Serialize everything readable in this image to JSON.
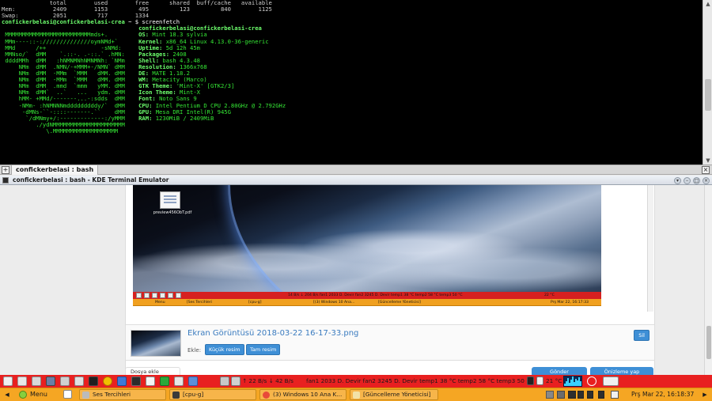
{
  "terminal": {
    "lines": [
      [
        {
          "t": "              total        used        free      shared  buff/cache   available",
          "c": "t-dim"
        }
      ],
      [
        {
          "t": "Mem:           2409        1153         495         123         840        1125",
          "c": "t-dim"
        }
      ],
      [
        {
          "t": "Swap:          2051         717        1334",
          "c": "t-dim"
        }
      ],
      [
        {
          "t": "confickerbelasi@confickerbelasi-crea",
          "c": "t-bgreen"
        },
        {
          "t": " ~ $ screenfetch",
          "c": "t-white"
        }
      ],
      [
        {
          "t": "                                        ",
          "c": ""
        },
        {
          "t": "confickerbelasi@confickerbelasi-crea",
          "c": "t-bgreen"
        }
      ],
      [
        {
          "t": " MMMMMMMMMMMMMMMMMMMMMMMMMmds+.         ",
          "c": "t-green"
        },
        {
          "t": "OS: ",
          "c": "t-bgreen"
        },
        {
          "t": "Mint 18.3 sylvia",
          "c": "t-green"
        }
      ],
      [
        {
          "t": " MMm----::-://////////////oymNMd+`      ",
          "c": "t-green"
        },
        {
          "t": "Kernel: ",
          "c": "t-bgreen"
        },
        {
          "t": "x86_64 Linux 4.13.0-36-generic",
          "c": "t-green"
        }
      ],
      [
        {
          "t": " MMd      /++                -sNMd:     ",
          "c": "t-green"
        },
        {
          "t": "Uptime: ",
          "c": "t-bgreen"
        },
        {
          "t": "5d 12h 45m",
          "c": "t-green"
        }
      ],
      [
        {
          "t": " MMNso/`  dMM    `.::-. .-::.` .hMN:    ",
          "c": "t-green"
        },
        {
          "t": "Packages: ",
          "c": "t-bgreen"
        },
        {
          "t": "2408",
          "c": "t-green"
        }
      ],
      [
        {
          "t": " ddddMMh  dMM   :hNMNMNhNMNMNh: `NMm    ",
          "c": "t-green"
        },
        {
          "t": "Shell: ",
          "c": "t-bgreen"
        },
        {
          "t": "bash 4.3.48",
          "c": "t-green"
        }
      ],
      [
        {
          "t": "     NMm  dMM  .NMN/-+MMM+-/NMN` dMM    ",
          "c": "t-green"
        },
        {
          "t": "Resolution: ",
          "c": "t-bgreen"
        },
        {
          "t": "1366x768",
          "c": "t-green"
        }
      ],
      [
        {
          "t": "     NMm  dMM  -MMm  `MMM   dMM. dMM    ",
          "c": "t-green"
        },
        {
          "t": "DE: ",
          "c": "t-bgreen"
        },
        {
          "t": "MATE 1.18.2",
          "c": "t-green"
        }
      ],
      [
        {
          "t": "     NMm  dMM  -MMm  `MMM   dMM. dMM    ",
          "c": "t-green"
        },
        {
          "t": "WM: ",
          "c": "t-bgreen"
        },
        {
          "t": "Metacity (Marco)",
          "c": "t-green"
        }
      ],
      [
        {
          "t": "     NMm  dMM  .mmd  `mmm   yMM. dMM    ",
          "c": "t-green"
        },
        {
          "t": "GTK Theme: ",
          "c": "t-bgreen"
        },
        {
          "t": "'Mint-X' [GTK2/3]",
          "c": "t-green"
        }
      ],
      [
        {
          "t": "     NMm  dMM`  ..`   ...   ydm. dMM    ",
          "c": "t-green"
        },
        {
          "t": "Icon Theme: ",
          "c": "t-bgreen"
        },
        {
          "t": "Mint-X",
          "c": "t-green"
        }
      ],
      [
        {
          "t": "     hMM- +MMd/-------...-:sdds  dMM    ",
          "c": "t-green"
        },
        {
          "t": "Font: ",
          "c": "t-bgreen"
        },
        {
          "t": "Noto Sans 9",
          "c": "t-green"
        }
      ],
      [
        {
          "t": "     -NMm- :hNMNNNmdddddddddy/`  dMM    ",
          "c": "t-green"
        },
        {
          "t": "CPU: ",
          "c": "t-bgreen"
        },
        {
          "t": "Intel Pentium D CPU 2.80GHz @ 2.792GHz",
          "c": "t-green"
        }
      ],
      [
        {
          "t": "      -dMNs-``-::::-------.``    dMM    ",
          "c": "t-green"
        },
        {
          "t": "GPU: ",
          "c": "t-bgreen"
        },
        {
          "t": "Mesa DRI Intel(R) 945G",
          "c": "t-green"
        }
      ],
      [
        {
          "t": "       `/dMNmy+/:-------------:/yMMM    ",
          "c": "t-green"
        },
        {
          "t": "RAM: ",
          "c": "t-bgreen"
        },
        {
          "t": "1230MiB / 2409MiB",
          "c": "t-green"
        }
      ],
      [
        {
          "t": "          ./ydNMMMMMMMMMMMMMMMMMMMMM    ",
          "c": "t-green"
        }
      ],
      [
        {
          "t": "             \\.MMMMMMMMMMMMMMMMMMM      ",
          "c": "t-green"
        }
      ]
    ]
  },
  "tabbar": {
    "tab_label": "confickerbelasi : bash",
    "new_tab_glyph": "+",
    "close_glyph": "×"
  },
  "window": {
    "title": "confickerbelasi : bash - KDE Terminal Emulator"
  },
  "page": {
    "desktop_file_label": "preview456ObT.pdf",
    "mini_panel_top_text": "14 B/s  ↓ 204 B/s    fan1 2033 D. Devir fan2 3245 D. Devir temp1 38 °C temp2 58 °C temp3 50 °C",
    "mini_panel_top_temp": "22 °C",
    "mini_menu": "Menu",
    "mini_tasks": [
      "[Ses Tercihleri",
      "[cpu-g]",
      "[(3) Windows 10 Ana...",
      "[Güncelleme Yöneticisi]"
    ],
    "mini_clock": "Prş Mar 22, 16:17:33",
    "attachment_name": "Ekran Görüntüsü 2018-03-22 16-17-33.png",
    "attachment_add_label": "Ekle:",
    "btn_small": "Küçük resim",
    "btn_full": "Tam resim",
    "btn_delete": "Sil",
    "btn_file_partial": "Dosya ekle",
    "btn_a_partial": "Gönder",
    "btn_b_partial": "Önizleme yap"
  },
  "panel_top": {
    "net_up": "↑ 22 B/s",
    "net_down": "↓ 42 B/s",
    "sensors": "fan1 2033 D. Devir fan2 3245 D. Devir temp1 38 °C temp2 58 °C temp3 50 °C",
    "temp": "21 °C"
  },
  "panel_bot": {
    "menu_label": "Menu",
    "tasks": [
      {
        "label": "Ses Tercihleri",
        "icon": "speaker-icon"
      },
      {
        "label": "[cpu-g]",
        "icon": "cpu-icon"
      },
      {
        "label": "(3) Windows 10 Ana K...",
        "icon": "chrome-icon"
      },
      {
        "label": "[Güncelleme Yöneticisi]",
        "icon": "shield-icon"
      }
    ],
    "clock": "Prş Mar 22, 16:18:37"
  },
  "colors": {
    "terminal_bg": "#000000",
    "terminal_green": "#35e835",
    "panel_red": "#e82020",
    "panel_orange": "#f5a623",
    "link_blue": "#3a7bbf",
    "button_blue": "#3e8fd6"
  }
}
